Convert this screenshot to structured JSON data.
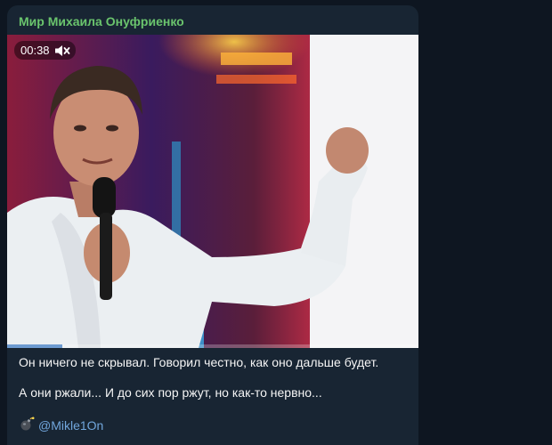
{
  "channel": {
    "name": "Мир Михаила Онуфриенко"
  },
  "video": {
    "duration": "00:38",
    "muted": true,
    "progress": 0.135,
    "icon_mute": "speaker-muted-icon"
  },
  "post": {
    "paragraphs": [
      "Он ничего не скрывал. Говорил честно, как оно дальше будет.",
      "А они ржали... И до сих пор ржут, но как-то нервно..."
    ],
    "signature": {
      "icon": "bomb-emoji-icon",
      "link": "@Mikle1On"
    }
  },
  "colors": {
    "background": "#0e1621",
    "bubble": "#182533",
    "channel_name": "#6ac46d",
    "link": "#71a6dc",
    "text": "#f5f5f5"
  }
}
